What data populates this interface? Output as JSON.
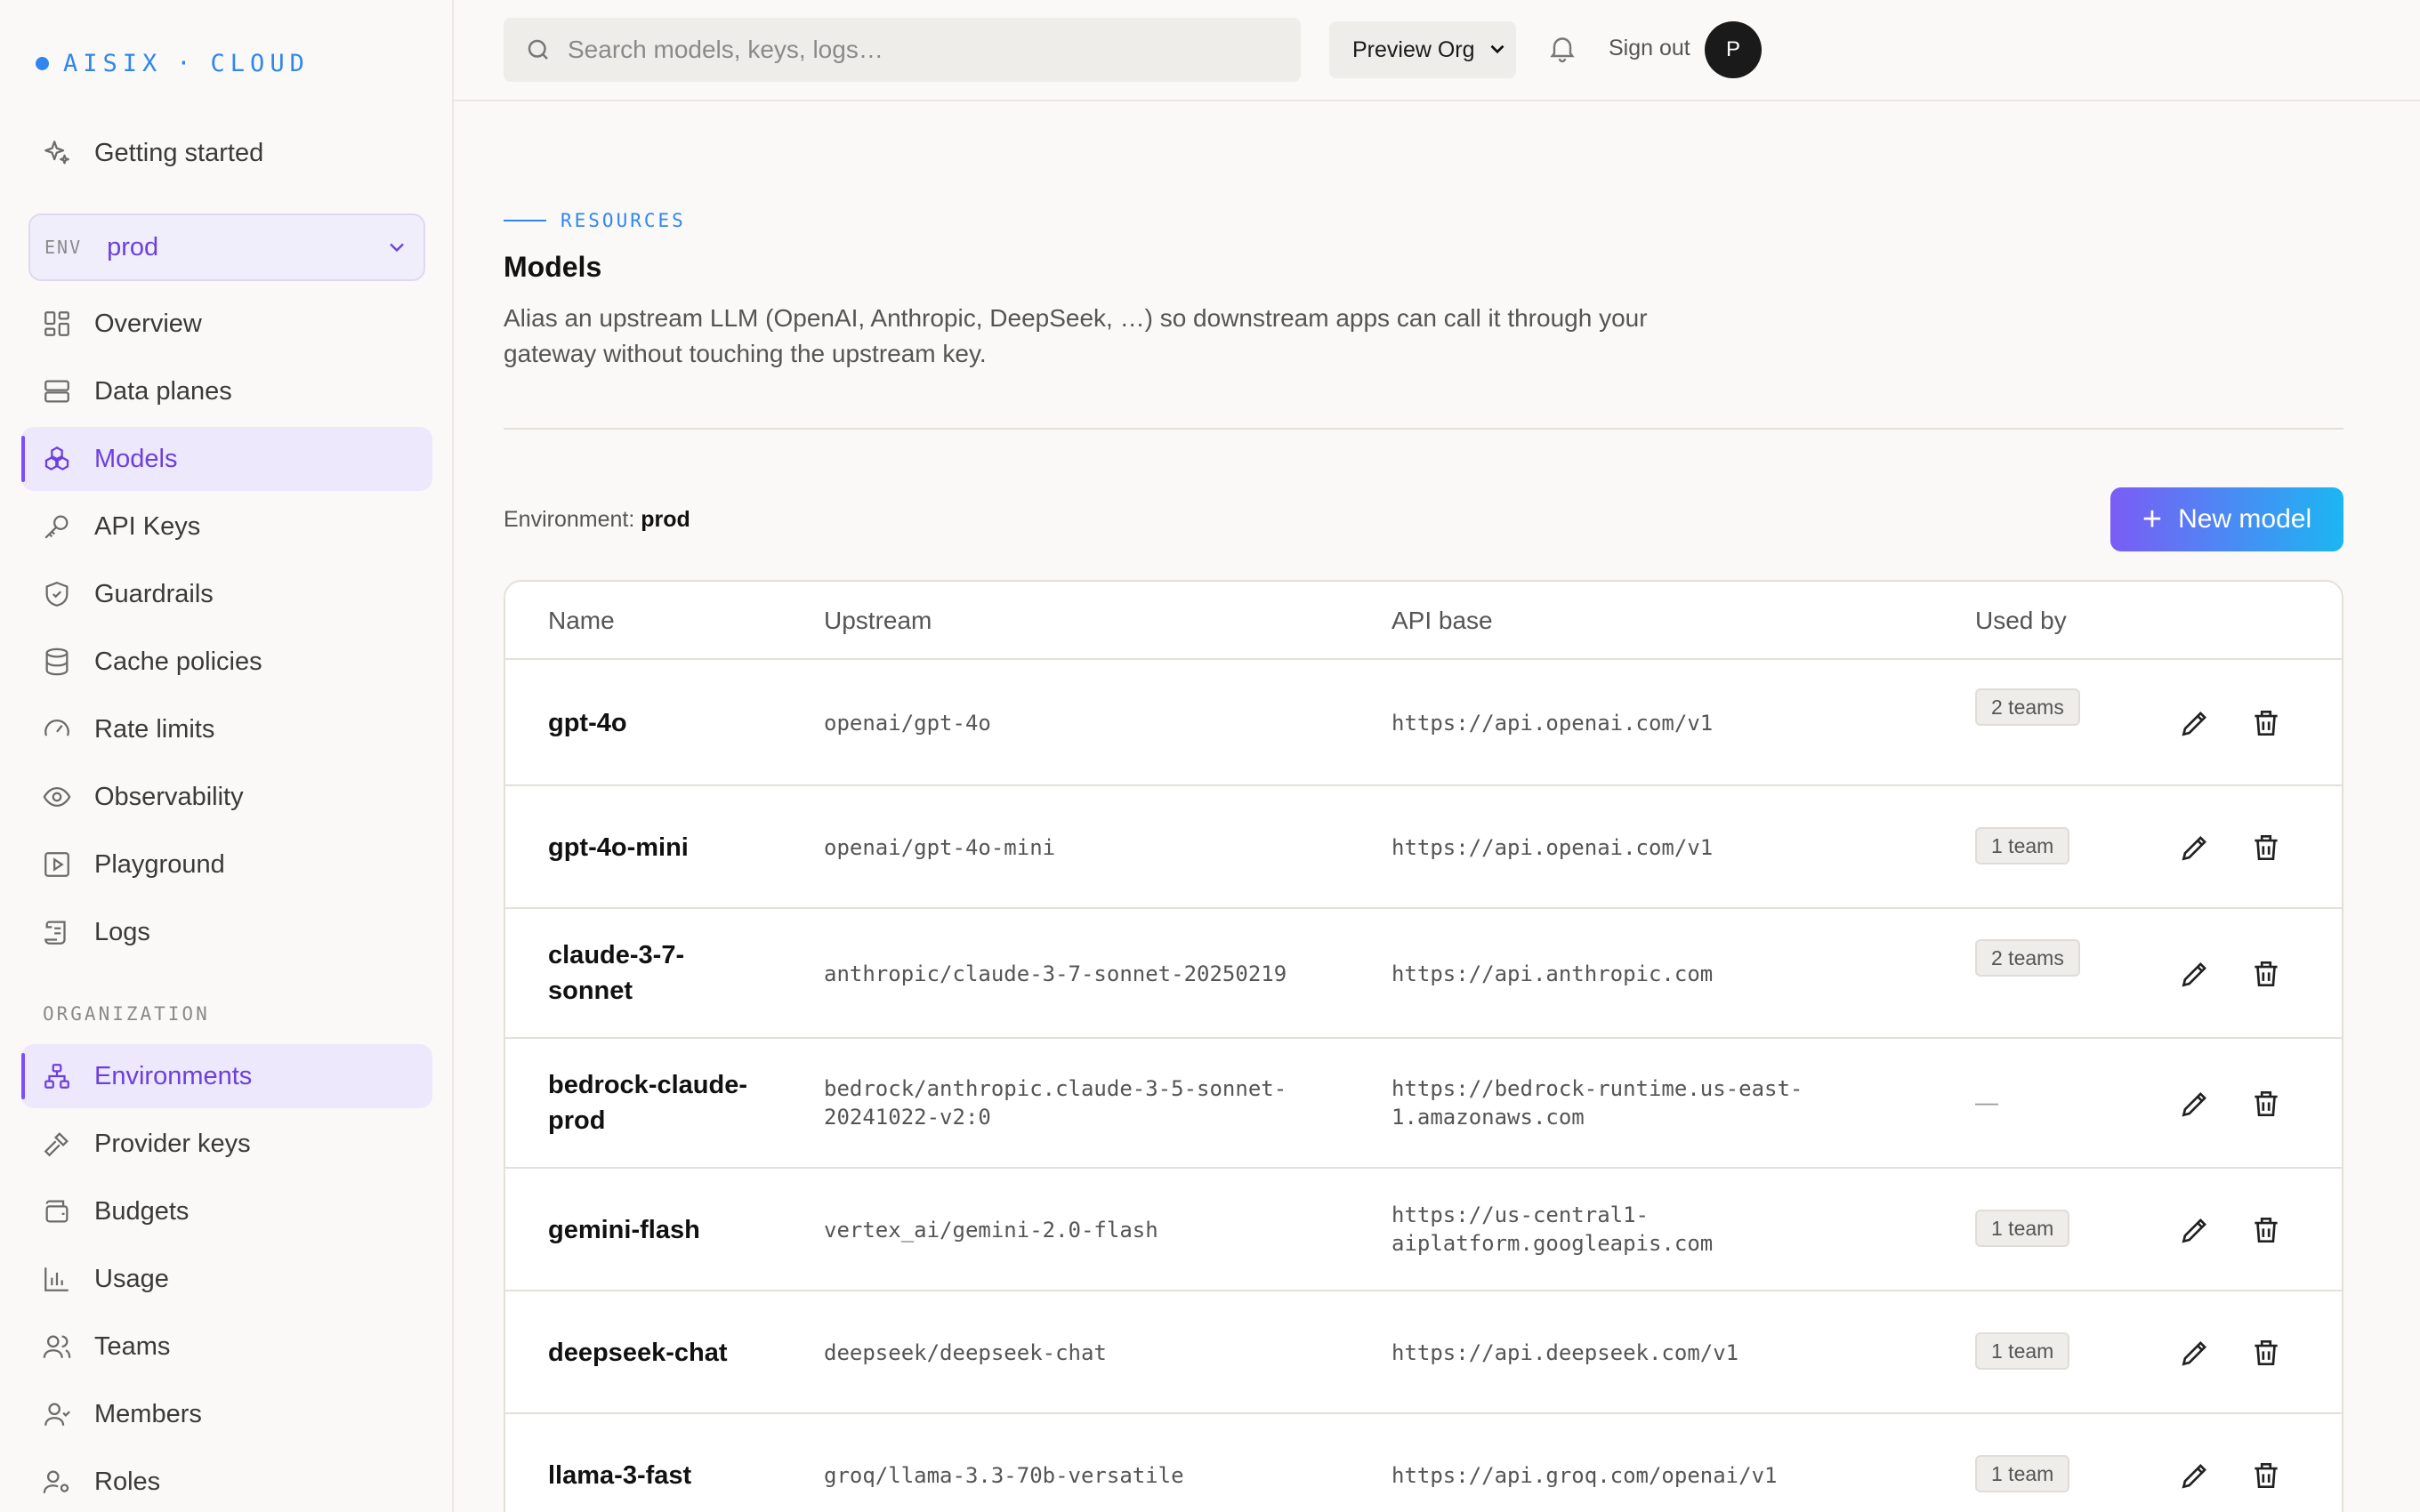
{
  "brand": {
    "name": "AISIX",
    "suffix": "CLOUD"
  },
  "sidebar": {
    "getting_started": "Getting started",
    "env": {
      "label": "ENV",
      "value": "prod"
    },
    "items": [
      {
        "label": "Overview",
        "icon": "grid-icon"
      },
      {
        "label": "Data planes",
        "icon": "server-icon"
      },
      {
        "label": "Models",
        "icon": "models-icon",
        "active": true
      },
      {
        "label": "API Keys",
        "icon": "key-icon"
      },
      {
        "label": "Guardrails",
        "icon": "shield-icon"
      },
      {
        "label": "Cache policies",
        "icon": "database-icon"
      },
      {
        "label": "Rate limits",
        "icon": "gauge-icon"
      },
      {
        "label": "Observability",
        "icon": "eye-icon"
      },
      {
        "label": "Playground",
        "icon": "play-icon"
      },
      {
        "label": "Logs",
        "icon": "scroll-icon"
      }
    ],
    "org_section_label": "ORGANIZATION",
    "org_items": [
      {
        "label": "Environments",
        "icon": "hierarchy-icon",
        "active": true
      },
      {
        "label": "Provider keys",
        "icon": "hammer-icon"
      },
      {
        "label": "Budgets",
        "icon": "wallet-icon"
      },
      {
        "label": "Usage",
        "icon": "bar-chart-icon"
      },
      {
        "label": "Teams",
        "icon": "users-icon"
      },
      {
        "label": "Members",
        "icon": "members-icon"
      },
      {
        "label": "Roles",
        "icon": "user-cog-icon"
      }
    ]
  },
  "topbar": {
    "search_placeholder": "Search models, keys, logs…",
    "org": "Preview Org",
    "signout": "Sign out",
    "avatar_initial": "P"
  },
  "page": {
    "kicker": "RESOURCES",
    "title": "Models",
    "description": "Alias an upstream LLM (OpenAI, Anthropic, DeepSeek, …) so downstream apps can call it through your gateway without touching the upstream key.",
    "env_label": "Environment:",
    "env_value": "prod",
    "new_button": "New model"
  },
  "table": {
    "headers": {
      "name": "Name",
      "upstream": "Upstream",
      "api_base": "API base",
      "used_by": "Used by"
    },
    "rows": [
      {
        "name": "gpt-4o",
        "upstream": "openai/gpt-4o",
        "api_base": "https://api.openai.com/v1",
        "used_by": "2 teams"
      },
      {
        "name": "gpt-4o-mini",
        "upstream": "openai/gpt-4o-mini",
        "api_base": "https://api.openai.com/v1",
        "used_by": "1 team"
      },
      {
        "name": "claude-3-7-sonnet",
        "upstream": "anthropic/claude-3-7-sonnet-20250219",
        "api_base": "https://api.anthropic.com",
        "used_by": "2 teams"
      },
      {
        "name": "bedrock-claude-prod",
        "upstream": "bedrock/anthropic.claude-3-5-sonnet-20241022-v2:0",
        "api_base": "https://bedrock-runtime.us-east-1.amazonaws.com",
        "used_by": "—"
      },
      {
        "name": "gemini-flash",
        "upstream": "vertex_ai/gemini-2.0-flash",
        "api_base": "https://us-central1-aiplatform.googleapis.com",
        "used_by": "1 team"
      },
      {
        "name": "deepseek-chat",
        "upstream": "deepseek/deepseek-chat",
        "api_base": "https://api.deepseek.com/v1",
        "used_by": "1 team"
      },
      {
        "name": "llama-3-fast",
        "upstream": "groq/llama-3.3-70b-versatile",
        "api_base": "https://api.groq.com/openai/v1",
        "used_by": "1 team"
      }
    ]
  }
}
